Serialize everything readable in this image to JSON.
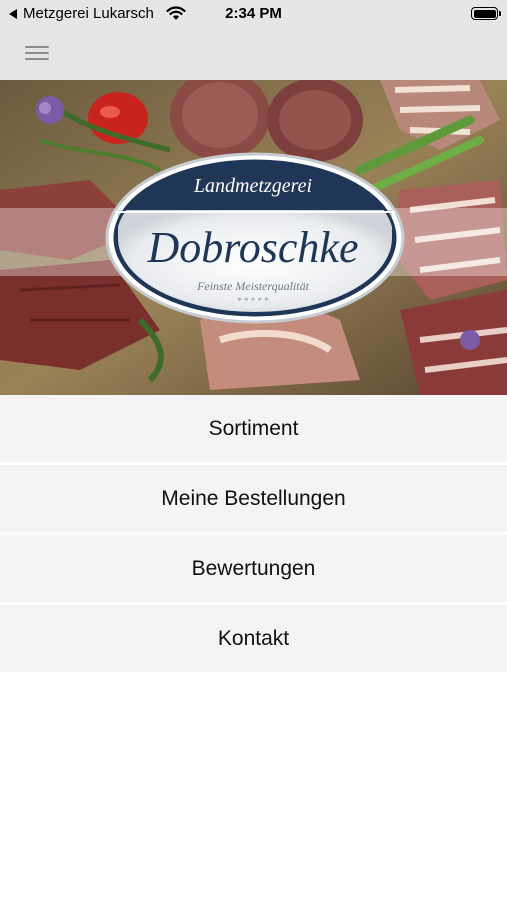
{
  "status_bar": {
    "back_app": "Metzgerei Lukarsch",
    "time": "2:34 PM"
  },
  "logo": {
    "top_text": "Landmetzgerei",
    "name": "Dobroschke",
    "tagline": "Feinste Meisterqualität",
    "stars": "* * * * *"
  },
  "menu": {
    "items": [
      {
        "label": "Sortiment"
      },
      {
        "label": "Meine Bestellungen"
      },
      {
        "label": "Bewertungen"
      },
      {
        "label": "Kontakt"
      }
    ]
  },
  "colors": {
    "navy": "#1f3657",
    "bar": "#e6e6e6",
    "row": "#f4f4f4"
  }
}
